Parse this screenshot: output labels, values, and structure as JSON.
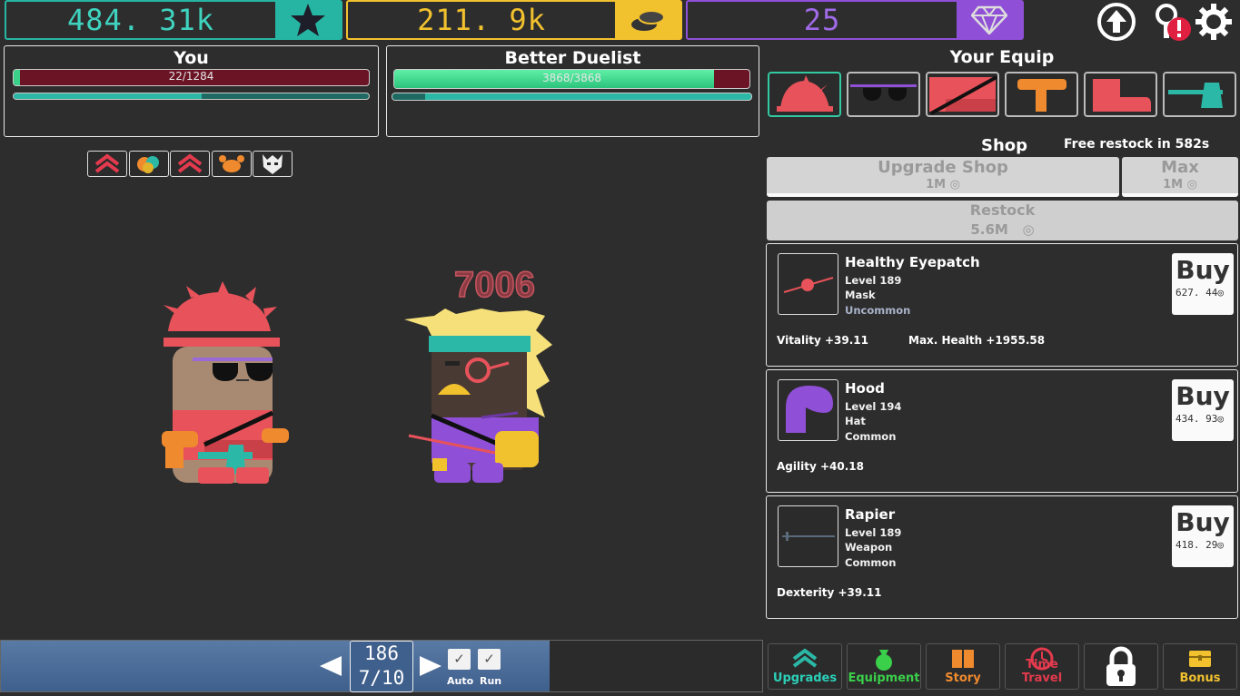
{
  "resources": {
    "stars": "484. 31k",
    "coins": "211. 9k",
    "gems": "25"
  },
  "player": {
    "title": "You",
    "health_text": "22/1284",
    "health_fraction": 0.017,
    "xp_fraction": 0.53
  },
  "enemy": {
    "title": "Better Duelist",
    "health_text": "3868/3868",
    "health_fraction": 0.9,
    "xp_fraction": 0.09
  },
  "damage_number": "7006",
  "equip": {
    "title": "Your Equip",
    "slots": [
      "hat-slot",
      "glasses-slot",
      "armor-slot",
      "weapon-slot",
      "boots-slot",
      "axe-slot"
    ]
  },
  "shop": {
    "title": "Shop",
    "restock_timer": "Free restock in 582s",
    "upgrade_label": "Upgrade Shop",
    "upgrade_price": "1M",
    "max_label": "Max",
    "max_price": "1M",
    "restock_label": "Restock",
    "restock_price": "5.6M",
    "buy_label": "Buy",
    "items": [
      {
        "name": "Healthy Eyepatch",
        "level": "Level 189",
        "type": "Mask",
        "rarity": "Uncommon",
        "price": "627. 44",
        "stat1": "Vitality +39.11",
        "stat2": "Max. Health +1955.58"
      },
      {
        "name": "Hood",
        "level": "Level 194",
        "type": "Hat",
        "rarity": "Common",
        "price": "434. 93",
        "stat1": "Agility +40.18",
        "stat2": ""
      },
      {
        "name": "Rapier",
        "level": "Level 189",
        "type": "Weapon",
        "rarity": "Common",
        "price": "418. 29",
        "stat1": "Dexterity +39.11",
        "stat2": ""
      }
    ]
  },
  "stage": {
    "level": "186",
    "wave": "7/10",
    "auto_label": "Auto",
    "run_label": "Run"
  },
  "nav": {
    "upgrades": "Upgrades",
    "equipment": "Equipment",
    "story": "Story",
    "time_travel": "Time Travel",
    "bonus": "Bonus"
  },
  "colors": {
    "teal": "#26b5a3",
    "gold": "#f2c12e",
    "purple": "#8f4fd6",
    "red": "#e8525a"
  }
}
